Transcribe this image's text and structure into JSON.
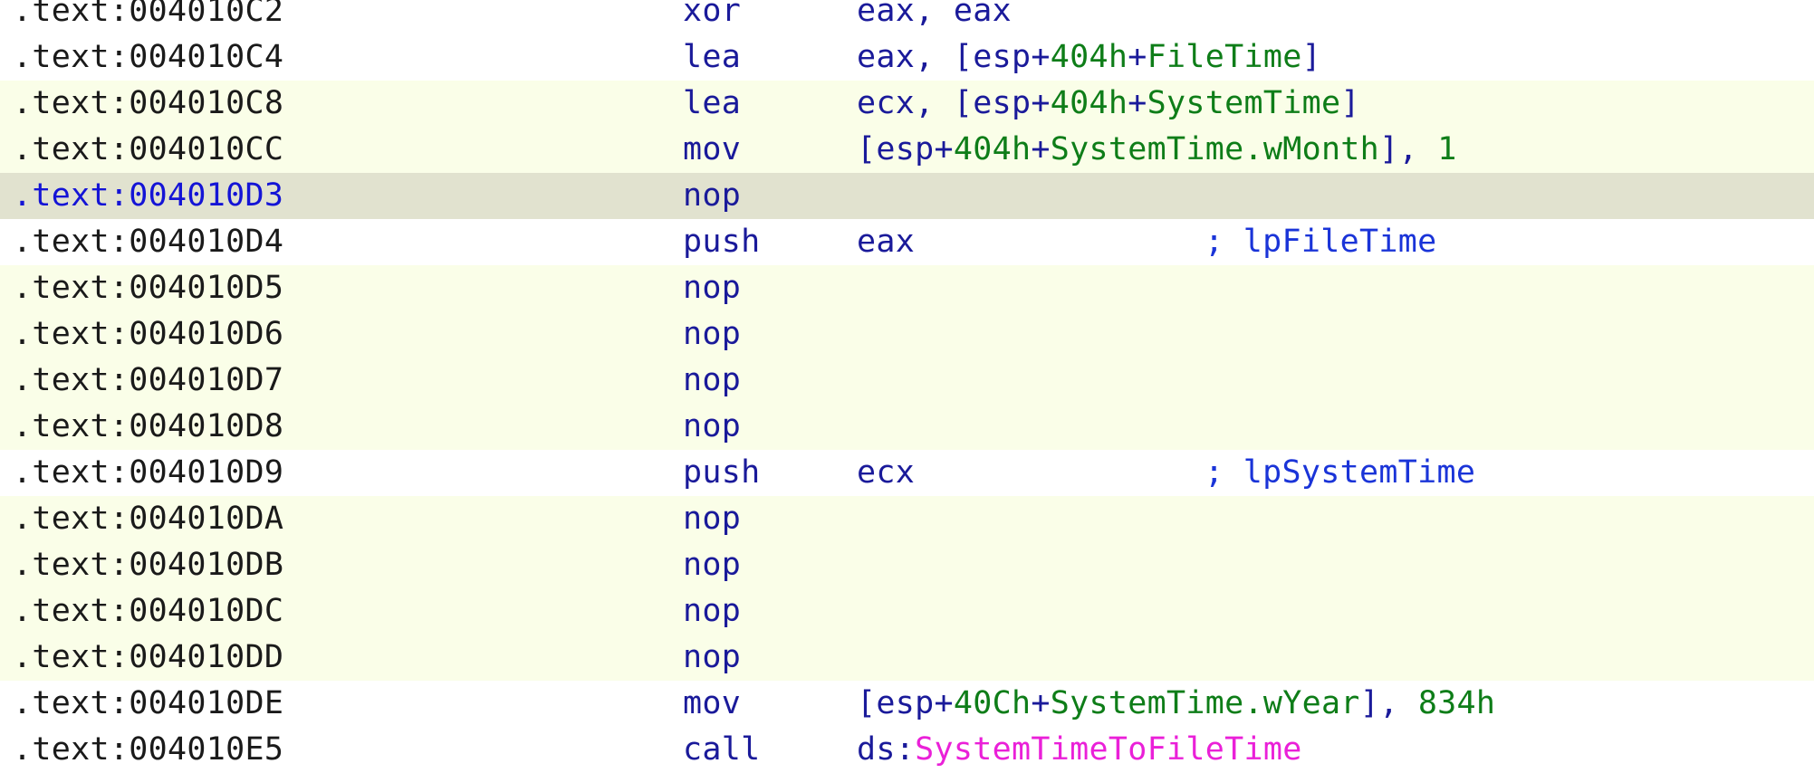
{
  "colors": {
    "row_background": "#ffffff",
    "row_background_pale": "#fafee8",
    "row_background_selected": "#e1e2cf",
    "address_text": "#1a1a1a",
    "address_text_selected": "#1414d6",
    "instruction_text": "#1a1a9a",
    "numbers_and_names": "#0e7d18",
    "comment_text": "#1a34d8",
    "imported_function": "#ea20d8"
  },
  "rows": [
    {
      "address": ".text:004010C2",
      "mnemonic": "xor",
      "operands": [
        {
          "text": "eax, eax",
          "kind": "reg"
        }
      ],
      "comment": "",
      "state": "normal"
    },
    {
      "address": ".text:004010C4",
      "mnemonic": "lea",
      "operands": [
        {
          "text": "eax, [esp+",
          "kind": "reg"
        },
        {
          "text": "404h",
          "kind": "num"
        },
        {
          "text": "+",
          "kind": "punc"
        },
        {
          "text": "FileTime",
          "kind": "name"
        },
        {
          "text": "]",
          "kind": "punc"
        }
      ],
      "comment": "",
      "state": "normal"
    },
    {
      "address": ".text:004010C8",
      "mnemonic": "lea",
      "operands": [
        {
          "text": "ecx, [esp+",
          "kind": "reg"
        },
        {
          "text": "404h",
          "kind": "num"
        },
        {
          "text": "+",
          "kind": "punc"
        },
        {
          "text": "SystemTime",
          "kind": "name"
        },
        {
          "text": "]",
          "kind": "punc"
        }
      ],
      "comment": "",
      "state": "pale"
    },
    {
      "address": ".text:004010CC",
      "mnemonic": "mov",
      "operands": [
        {
          "text": "[esp+",
          "kind": "reg"
        },
        {
          "text": "404h",
          "kind": "num"
        },
        {
          "text": "+",
          "kind": "punc"
        },
        {
          "text": "SystemTime.wMonth",
          "kind": "name"
        },
        {
          "text": "], ",
          "kind": "punc"
        },
        {
          "text": "1",
          "kind": "num"
        }
      ],
      "comment": "",
      "state": "pale"
    },
    {
      "address": ".text:004010D3",
      "mnemonic": "nop",
      "operands": [],
      "comment": "",
      "state": "selected"
    },
    {
      "address": ".text:004010D4",
      "mnemonic": "push",
      "operands": [
        {
          "text": "eax",
          "kind": "reg"
        }
      ],
      "comment": "; lpFileTime",
      "state": "normal"
    },
    {
      "address": ".text:004010D5",
      "mnemonic": "nop",
      "operands": [],
      "comment": "",
      "state": "pale"
    },
    {
      "address": ".text:004010D6",
      "mnemonic": "nop",
      "operands": [],
      "comment": "",
      "state": "pale"
    },
    {
      "address": ".text:004010D7",
      "mnemonic": "nop",
      "operands": [],
      "comment": "",
      "state": "pale"
    },
    {
      "address": ".text:004010D8",
      "mnemonic": "nop",
      "operands": [],
      "comment": "",
      "state": "pale"
    },
    {
      "address": ".text:004010D9",
      "mnemonic": "push",
      "operands": [
        {
          "text": "ecx",
          "kind": "reg"
        }
      ],
      "comment": "; lpSystemTime",
      "state": "normal"
    },
    {
      "address": ".text:004010DA",
      "mnemonic": "nop",
      "operands": [],
      "comment": "",
      "state": "pale"
    },
    {
      "address": ".text:004010DB",
      "mnemonic": "nop",
      "operands": [],
      "comment": "",
      "state": "pale"
    },
    {
      "address": ".text:004010DC",
      "mnemonic": "nop",
      "operands": [],
      "comment": "",
      "state": "pale"
    },
    {
      "address": ".text:004010DD",
      "mnemonic": "nop",
      "operands": [],
      "comment": "",
      "state": "pale"
    },
    {
      "address": ".text:004010DE",
      "mnemonic": "mov",
      "operands": [
        {
          "text": "[esp+",
          "kind": "reg"
        },
        {
          "text": "40Ch",
          "kind": "num"
        },
        {
          "text": "+",
          "kind": "punc"
        },
        {
          "text": "SystemTime.wYear",
          "kind": "name"
        },
        {
          "text": "], ",
          "kind": "punc"
        },
        {
          "text": "834h",
          "kind": "num"
        }
      ],
      "comment": "",
      "state": "normal"
    },
    {
      "address": ".text:004010E5",
      "mnemonic": "call",
      "operands": [
        {
          "text": "ds:",
          "kind": "seg"
        },
        {
          "text": "SystemTimeToFileTime",
          "kind": "import"
        }
      ],
      "comment": "",
      "state": "normal"
    }
  ]
}
